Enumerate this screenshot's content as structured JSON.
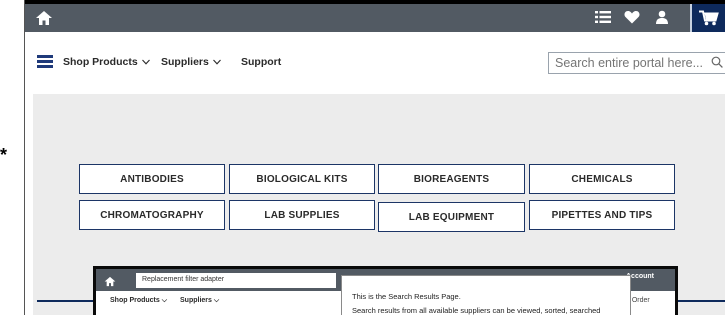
{
  "stray_mark": "*",
  "header": {
    "icons": [
      "home-icon",
      "list-icon",
      "heart-icon",
      "user-icon",
      "cart-icon"
    ],
    "bar_color": "#525a63",
    "cart_color": "#0e2a5c"
  },
  "nav": {
    "items": [
      {
        "label": "Shop Products",
        "has_dropdown": true
      },
      {
        "label": "Suppliers",
        "has_dropdown": true
      },
      {
        "label": "Support",
        "has_dropdown": false
      }
    ],
    "search": {
      "placeholder": "Search entire portal here..."
    }
  },
  "categories": [
    [
      "ANTIBODIES",
      "BIOLOGICAL KITS",
      "BIOREAGENTS",
      "CHEMICALS"
    ],
    [
      "CHROMATOGRAPHY",
      "LAB SUPPLIES",
      "LAB EQUIPMENT",
      "PIPETTES AND TIPS"
    ]
  ],
  "inset": {
    "search_value": "Replacement filter adapter",
    "nav": [
      "Shop Products",
      "Suppliers"
    ],
    "account": "Account",
    "order": "e Order"
  },
  "tooltip": {
    "line1": "This is the Search Results Page.",
    "line2": "Search results from all available suppliers can be viewed, sorted, searched"
  },
  "colors": {
    "accent": "#1c3566",
    "hero_bg": "#ececec"
  }
}
